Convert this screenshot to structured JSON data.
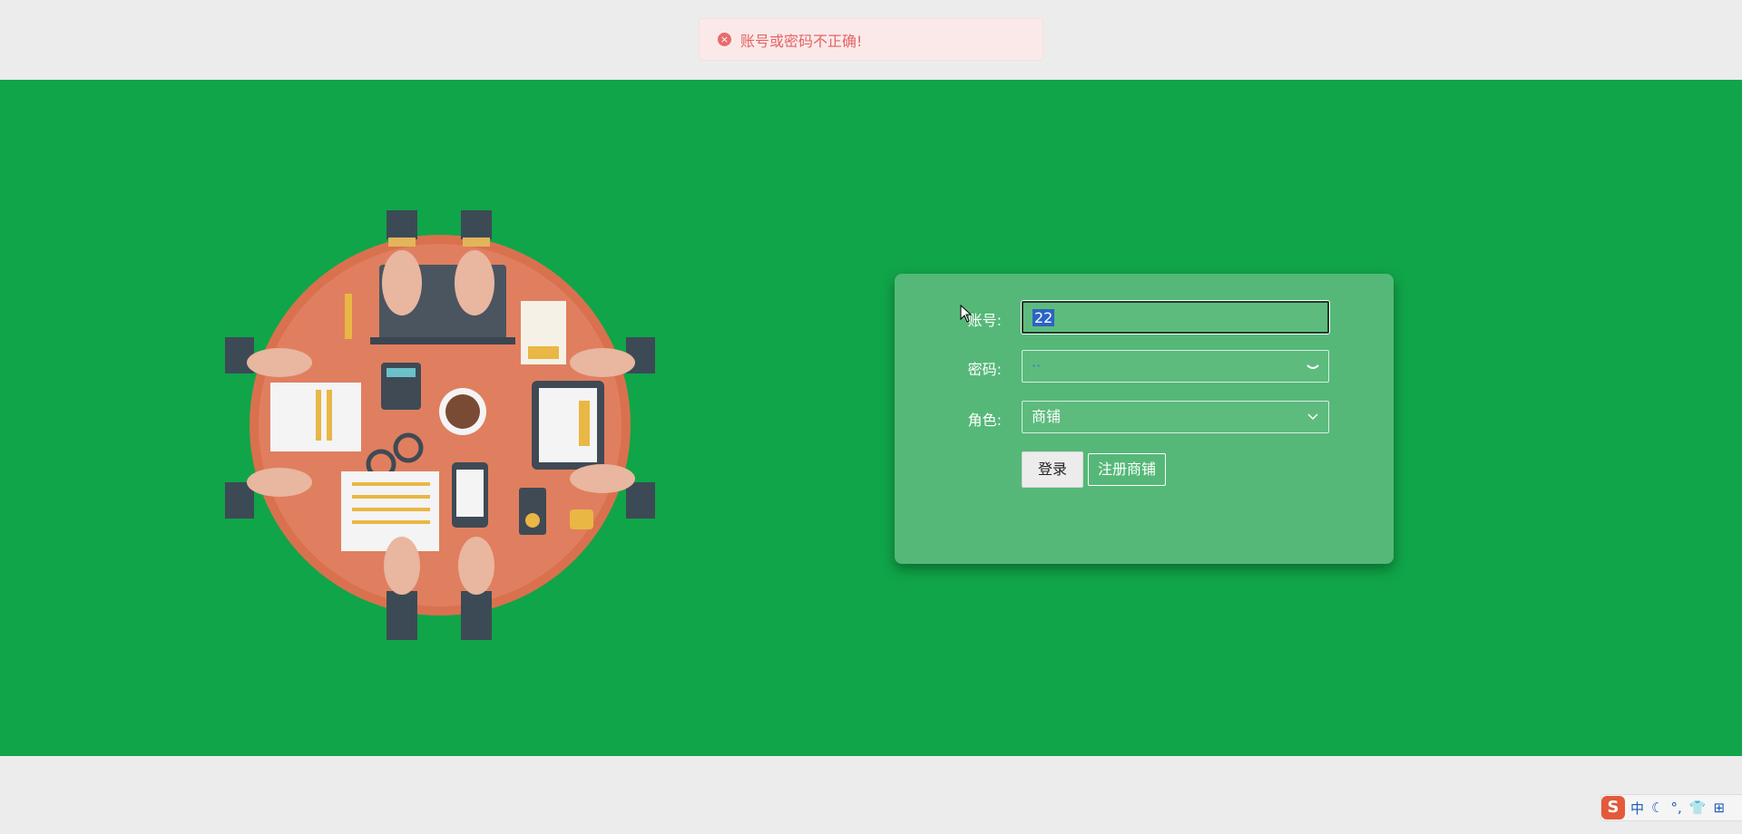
{
  "alert": {
    "message": "账号或密码不正确!",
    "icon": "error-circle-icon",
    "icon_glyph": "×"
  },
  "login": {
    "account_label": "账号:",
    "account_value": "22",
    "password_label": "密码:",
    "password_value": "··",
    "password_toggle_icon": "eye-closed-icon",
    "role_label": "角色:",
    "role_value": "商铺",
    "role_dropdown_icon": "chevron-down-icon",
    "login_button": "登录",
    "register_button": "注册商铺"
  },
  "ime": {
    "logo": "S",
    "items": [
      "中",
      "☾",
      "°,",
      "👕",
      "⊞"
    ]
  },
  "colors": {
    "background_green": "#10a548",
    "card_green": "#55b878",
    "alert_text": "#e46464",
    "table_orange": "#e07f5f"
  }
}
